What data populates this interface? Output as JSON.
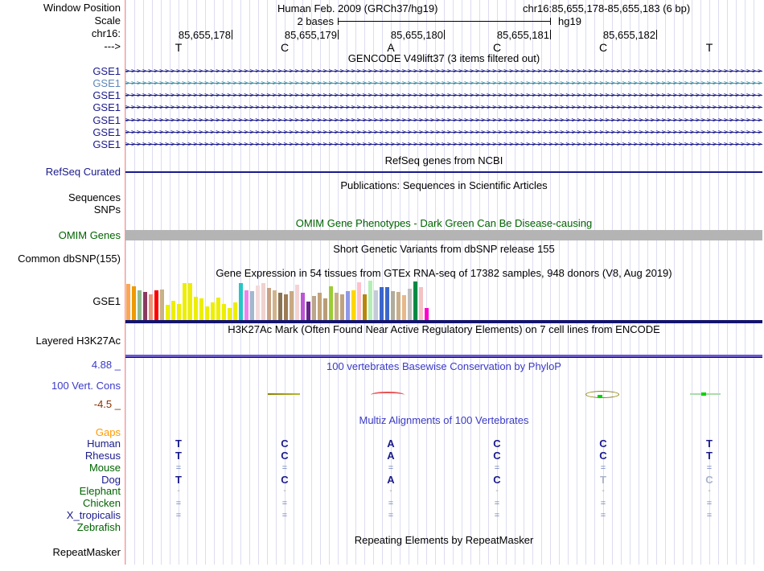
{
  "header": {
    "window_position_label": "Window Position",
    "assembly": "Human Feb. 2009 (GRCh37/hg19)",
    "position": "chr16:85,655,178-85,655,183 (6 bp)",
    "scale_label": "Scale",
    "scale_text": "2 bases",
    "scale_genome": "hg19",
    "chrom_label": "chr16:",
    "strand_label": "--->",
    "coordinates": [
      "85,655,178",
      "85,655,179",
      "85,655,180",
      "85,655,181",
      "85,655,182"
    ],
    "bases": [
      "T",
      "C",
      "A",
      "C",
      "C",
      "T"
    ]
  },
  "tracks": {
    "gencode_title": "GENCODE V49lift37 (3 items filtered out)",
    "gse1_rows": [
      {
        "label": "GSE1",
        "color": "#1a1a8c"
      },
      {
        "label": "GSE1",
        "color": "#3b8ea5"
      },
      {
        "label": "GSE1",
        "color": "#1a1a8c"
      },
      {
        "label": "GSE1",
        "color": "#1a1a8c"
      },
      {
        "label": "GSE1",
        "color": "#1a1a8c"
      },
      {
        "label": "GSE1",
        "color": "#1a1a8c"
      },
      {
        "label": "GSE1",
        "color": "#1a1a8c"
      }
    ],
    "refseq_title": "RefSeq genes from NCBI",
    "refseq_label": "RefSeq Curated",
    "publications_title": "Publications: Sequences in Scientific Articles",
    "sequences_label": "Sequences",
    "snps_label": "SNPs",
    "omim_title": "OMIM Gene Phenotypes - Dark Green Can Be Disease-causing",
    "omim_label": "OMIM Genes",
    "dbsnp_title": "Short Genetic Variants from dbSNP release 155",
    "dbsnp_label": "Common dbSNP(155)",
    "gtex_title": "Gene Expression in 54 tissues from GTEx RNA-seq of 17382 samples, 948 donors (V8, Aug 2019)",
    "gtex_label": "GSE1",
    "h3k27ac_title": "H3K27Ac Mark (Often Found Near Active Regulatory Elements) on 7 cell lines from ENCODE",
    "h3k27ac_label": "Layered H3K27Ac",
    "phylop_title": "100 vertebrates Basewise Conservation by PhyloP",
    "phylop_label": "100 Vert. Cons",
    "phylop_max": "4.88 _",
    "phylop_min": "-4.5 _",
    "multiz_title": "Multiz Alignments of 100 Vertebrates",
    "repeat_title": "Repeating Elements by RepeatMasker",
    "repeat_label": "RepeatMasker"
  },
  "multiz": {
    "rows": [
      {
        "label": "Gaps",
        "color": "#ff9900",
        "cells": []
      },
      {
        "label": "Human",
        "color": "#1a1a8c",
        "cells": [
          {
            "t": "T"
          },
          {
            "t": "C"
          },
          {
            "t": "A"
          },
          {
            "t": "C"
          },
          {
            "t": "C"
          },
          {
            "t": "T"
          }
        ]
      },
      {
        "label": "Rhesus",
        "color": "#1a1a8c",
        "cells": [
          {
            "t": "T"
          },
          {
            "t": "C"
          },
          {
            "t": "A"
          },
          {
            "t": "C"
          },
          {
            "t": "C"
          },
          {
            "t": "T"
          }
        ]
      },
      {
        "label": "Mouse",
        "color": "#006400",
        "cells": [
          {
            "t": "="
          },
          {
            "t": "="
          },
          {
            "t": "="
          },
          {
            "t": "="
          },
          {
            "t": "="
          },
          {
            "t": "="
          }
        ]
      },
      {
        "label": "Dog",
        "color": "#1a1a8c",
        "cells": [
          {
            "t": "T"
          },
          {
            "t": "C"
          },
          {
            "t": "A"
          },
          {
            "t": "C"
          },
          {
            "t": "T",
            "pale": true
          },
          {
            "t": "C",
            "pale": true
          }
        ]
      },
      {
        "label": "Elephant",
        "color": "#006400",
        "cells": [
          {
            "t": "-"
          },
          {
            "t": "-"
          },
          {
            "t": "-"
          },
          {
            "t": "-"
          },
          {
            "t": "-"
          },
          {
            "t": "-"
          }
        ]
      },
      {
        "label": "Chicken",
        "color": "#006400",
        "cells": [
          {
            "t": "="
          },
          {
            "t": "="
          },
          {
            "t": "="
          },
          {
            "t": "="
          },
          {
            "t": "="
          },
          {
            "t": "="
          }
        ]
      },
      {
        "label": "X_tropicalis",
        "color": "#1a1a8c",
        "cells": [
          {
            "t": "="
          },
          {
            "t": "="
          },
          {
            "t": "="
          },
          {
            "t": "="
          },
          {
            "t": "="
          },
          {
            "t": "="
          }
        ]
      },
      {
        "label": "Zebrafish",
        "color": "#006400",
        "cells": []
      }
    ]
  },
  "chart_data": {
    "type": "bar",
    "title": "Gene Expression in 54 tissues from GTEx RNA-seq of 17382 samples, 948 donors (V8, Aug 2019)",
    "gene": "GSE1",
    "ylim": [
      0,
      50
    ],
    "bars": [
      {
        "c": "#ffa54f",
        "h": 46
      },
      {
        "c": "#ee9a00",
        "h": 43
      },
      {
        "c": "#8fbc8f",
        "h": 38
      },
      {
        "c": "#8b3a62",
        "h": 36
      },
      {
        "c": "#e9967a",
        "h": 33
      },
      {
        "c": "#ff0000",
        "h": 38
      },
      {
        "c": "#c8b189",
        "h": 39
      },
      {
        "c": "#eeee00",
        "h": 20
      },
      {
        "c": "#eeee00",
        "h": 25
      },
      {
        "c": "#eeee00",
        "h": 21
      },
      {
        "c": "#eeee00",
        "h": 47
      },
      {
        "c": "#eeee00",
        "h": 47
      },
      {
        "c": "#eeee00",
        "h": 30
      },
      {
        "c": "#eeee00",
        "h": 28
      },
      {
        "c": "#eeee00",
        "h": 18
      },
      {
        "c": "#eeee00",
        "h": 23
      },
      {
        "c": "#eeee00",
        "h": 29
      },
      {
        "c": "#eeee00",
        "h": 21
      },
      {
        "c": "#eeee00",
        "h": 16
      },
      {
        "c": "#eeee00",
        "h": 23
      },
      {
        "c": "#26c6c6",
        "h": 47
      },
      {
        "c": "#ee82ee",
        "h": 38
      },
      {
        "c": "#a3b8cc",
        "h": 37
      },
      {
        "c": "#f3dada",
        "h": 44
      },
      {
        "c": "#f0d2ce",
        "h": 47
      },
      {
        "c": "#c8a284",
        "h": 41
      },
      {
        "c": "#d2b48c",
        "h": 38
      },
      {
        "c": "#8b7355",
        "h": 35
      },
      {
        "c": "#9c7c55",
        "h": 33
      },
      {
        "c": "#c8a983",
        "h": 37
      },
      {
        "c": "#f5d3d3",
        "h": 45
      },
      {
        "c": "#ba55d3",
        "h": 35
      },
      {
        "c": "#68228b",
        "h": 24
      },
      {
        "c": "#bca68c",
        "h": 31
      },
      {
        "c": "#c3a379",
        "h": 35
      },
      {
        "c": "#b99c77",
        "h": 28
      },
      {
        "c": "#9acd32",
        "h": 43
      },
      {
        "c": "#c8ae88",
        "h": 35
      },
      {
        "c": "#bfa380",
        "h": 33
      },
      {
        "c": "#8e99e6",
        "h": 37
      },
      {
        "c": "#ffd700",
        "h": 38
      },
      {
        "c": "#ffc0cb",
        "h": 48
      },
      {
        "c": "#b8860b",
        "h": 33
      },
      {
        "c": "#b4eeb4",
        "h": 50
      },
      {
        "c": "#c4cbd8",
        "h": 38
      },
      {
        "c": "#3a66cc",
        "h": 42
      },
      {
        "c": "#3a66cc",
        "h": 42
      },
      {
        "c": "#b0ac9e",
        "h": 37
      },
      {
        "c": "#c9ae8c",
        "h": 36
      },
      {
        "c": "#e8b88a",
        "h": 32
      },
      {
        "c": "#bebebe",
        "h": 40
      },
      {
        "c": "#008b45",
        "h": 49
      },
      {
        "c": "#f4c2c2",
        "h": 42
      },
      {
        "c": "#ff00cc",
        "h": 16
      }
    ]
  },
  "colors": {
    "navy": "#1a1a8c",
    "teal_row": "#3b8ea5",
    "blue_text": "#3a3ac8",
    "green_text": "#006400",
    "dark_red_text": "#8b3000",
    "orange_text": "#ff9900",
    "grid": "#dcdcf2",
    "guideline": "#f59a9a",
    "omim_bar": "#b4b4b4",
    "h3k27ac_line": "#6b5acd"
  }
}
